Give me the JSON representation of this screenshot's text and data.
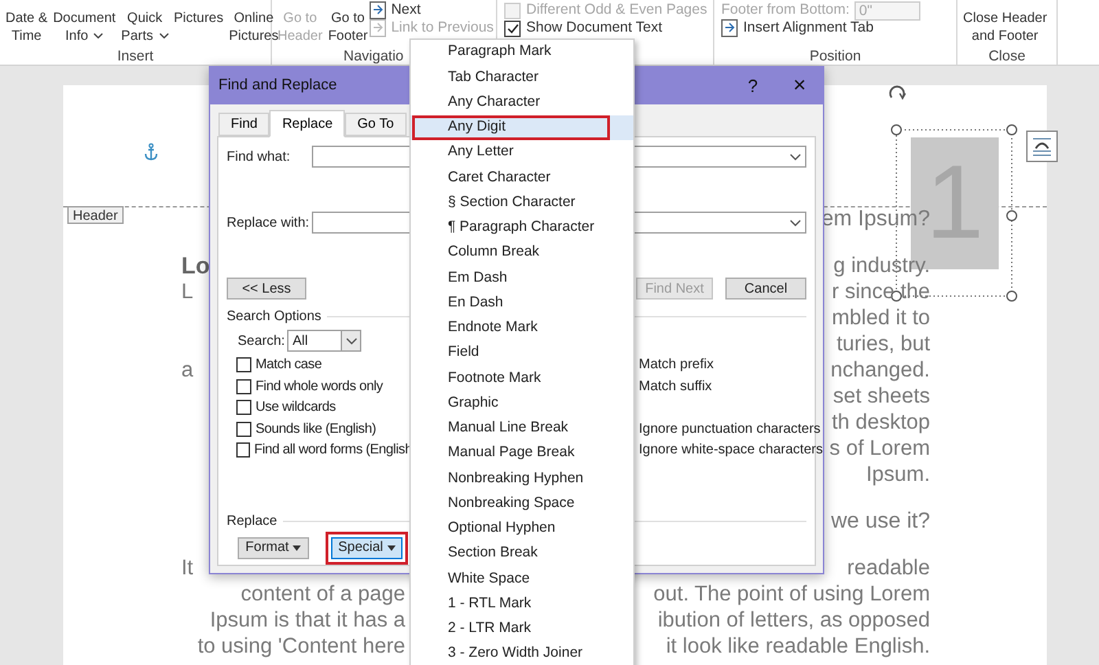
{
  "ribbon": {
    "groups": [
      {
        "label": "Insert",
        "items": [
          {
            "kind": "large",
            "lines": [
              "Date &",
              "Time"
            ],
            "dropdown": false,
            "disabled": false
          },
          {
            "kind": "large",
            "lines": [
              "Document",
              "Info"
            ],
            "dropdown": true,
            "disabled": false
          },
          {
            "kind": "large",
            "lines": [
              "Quick",
              "Parts"
            ],
            "dropdown": true,
            "disabled": false
          },
          {
            "kind": "large",
            "lines": [
              "Pictures"
            ],
            "dropdown": false,
            "disabled": false
          },
          {
            "kind": "large",
            "lines": [
              "Online",
              "Pictures"
            ],
            "dropdown": false,
            "disabled": false
          }
        ]
      },
      {
        "label": "Navigatio",
        "items": [
          {
            "kind": "large",
            "lines": [
              "Go to",
              "Header"
            ],
            "dropdown": false,
            "disabled": true
          },
          {
            "kind": "large",
            "lines": [
              "Go to",
              "Footer"
            ],
            "dropdown": false,
            "disabled": false
          },
          {
            "kind": "small",
            "label": "Next",
            "disabled": false
          },
          {
            "kind": "small",
            "label": "Link to Previous",
            "disabled": true
          }
        ]
      },
      {
        "items": [
          {
            "kind": "check",
            "label": "Different Odd & Even Pages",
            "checked": false,
            "disabled": true
          },
          {
            "kind": "check",
            "label": "Show Document Text",
            "checked": true,
            "disabled": false
          }
        ]
      },
      {
        "label": "Position",
        "items": [
          {
            "kind": "spin",
            "label": "Footer from Bottom:",
            "value": "0\"",
            "disabled": true
          },
          {
            "kind": "small",
            "label": "Insert Alignment Tab",
            "disabled": false
          }
        ]
      },
      {
        "label": "Close",
        "items": [
          {
            "kind": "large",
            "lines": [
              "Close Header",
              "and Footer"
            ],
            "dropdown": false,
            "disabled": false
          }
        ]
      }
    ]
  },
  "header": {
    "tag": "Header",
    "page_number": "1"
  },
  "document": {
    "paragraphs": [
      {
        "kind": "heading",
        "lines": [
          {
            "kind": "split",
            "right": "em Ipsum?"
          }
        ]
      },
      {
        "kind": "body",
        "lines": [
          {
            "kind": "split",
            "left": "Lo",
            "left_bold": true,
            "right": "g industry."
          },
          {
            "kind": "split",
            "left": "L",
            "right": "r since the"
          },
          {
            "kind": "split",
            "right": "mbled it to"
          },
          {
            "kind": "split",
            "right": "turies, but"
          },
          {
            "kind": "split",
            "left": "a",
            "right": "nchanged."
          },
          {
            "kind": "split",
            "right": "set sheets"
          },
          {
            "kind": "split",
            "right": "th desktop"
          },
          {
            "kind": "split",
            "right": "s of Lorem"
          },
          {
            "kind": "split",
            "right": "Ipsum."
          }
        ]
      },
      {
        "kind": "heading",
        "lines": [
          {
            "kind": "split",
            "right": "we use it?"
          }
        ]
      },
      {
        "kind": "body",
        "lines": [
          {
            "kind": "split",
            "left": "It",
            "right": "readable"
          },
          {
            "kind": "wrapped",
            "left": "content of a page",
            "right": "out. The point of using Lorem"
          },
          {
            "kind": "wrapped",
            "left": "Ipsum is that it has a",
            "right": "ibution of letters, as opposed"
          },
          {
            "kind": "wrapped",
            "left": "to using 'Content here",
            "right": "it look like readable English."
          }
        ]
      }
    ]
  },
  "dialog": {
    "title": "Find and Replace",
    "help": "?",
    "close": "×",
    "tabs": [
      {
        "label": "Find",
        "selected": false
      },
      {
        "label": "Replace",
        "selected": true
      },
      {
        "label": "Go To",
        "selected": false
      }
    ],
    "find_label": "Find what:",
    "replace_label": "Replace with:",
    "less_button": "<< Less",
    "find_next_button": {
      "label": "Find Next",
      "disabled": true
    },
    "cancel_button": "Cancel",
    "search_options_label": "Search Options",
    "search_label": "Search:",
    "search_value": "All",
    "options": [
      {
        "left": {
          "label": "Match case",
          "checked": false
        },
        "right": "Match prefix"
      },
      {
        "left": {
          "label": "Find whole words only",
          "checked": false
        },
        "right": "Match suffix"
      },
      {
        "left": {
          "label": "Use wildcards",
          "checked": false
        }
      },
      {
        "left": {
          "label": "Sounds like (English)",
          "checked": false
        },
        "right": "Ignore punctuation characters"
      },
      {
        "left": {
          "label": "Find all word forms (English",
          "checked": false
        },
        "right": "Ignore white-space characters"
      }
    ],
    "replace_section_label": "Replace",
    "buttons": [
      {
        "label": "Format",
        "selected": false,
        "outlined": false
      },
      {
        "label": "Special",
        "selected": true,
        "outlined": true
      }
    ]
  },
  "menu": {
    "items": [
      {
        "label": "Paragraph Mark",
        "selected": false,
        "outlined": false
      },
      {
        "label": "Tab Character",
        "selected": false,
        "outlined": false
      },
      {
        "label": "Any Character",
        "selected": false,
        "outlined": false
      },
      {
        "label": "Any Digit",
        "selected": true,
        "outlined": true
      },
      {
        "label": "Any Letter",
        "selected": false,
        "outlined": false
      },
      {
        "label": "Caret Character",
        "selected": false,
        "outlined": false
      },
      {
        "label": "§ Section Character",
        "selected": false,
        "outlined": false
      },
      {
        "label": "¶ Paragraph Character",
        "selected": false,
        "outlined": false
      },
      {
        "label": "Column Break",
        "selected": false,
        "outlined": false
      },
      {
        "label": "Em Dash",
        "selected": false,
        "outlined": false
      },
      {
        "label": "En Dash",
        "selected": false,
        "outlined": false
      },
      {
        "label": "Endnote Mark",
        "selected": false,
        "outlined": false
      },
      {
        "label": "Field",
        "selected": false,
        "outlined": false
      },
      {
        "label": "Footnote Mark",
        "selected": false,
        "outlined": false
      },
      {
        "label": "Graphic",
        "selected": false,
        "outlined": false
      },
      {
        "label": "Manual Line Break",
        "selected": false,
        "outlined": false
      },
      {
        "label": "Manual Page Break",
        "selected": false,
        "outlined": false
      },
      {
        "label": "Nonbreaking Hyphen",
        "selected": false,
        "outlined": false
      },
      {
        "label": "Nonbreaking Space",
        "selected": false,
        "outlined": false
      },
      {
        "label": "Optional Hyphen",
        "selected": false,
        "outlined": false
      },
      {
        "label": "Section Break",
        "selected": false,
        "outlined": false
      },
      {
        "label": "White Space",
        "selected": false,
        "outlined": false
      },
      {
        "label": "1 - RTL Mark",
        "selected": false,
        "outlined": false
      },
      {
        "label": "2 - LTR Mark",
        "selected": false,
        "outlined": false
      },
      {
        "label": "3 - Zero Width Joiner",
        "selected": false,
        "outlined": false
      }
    ]
  }
}
